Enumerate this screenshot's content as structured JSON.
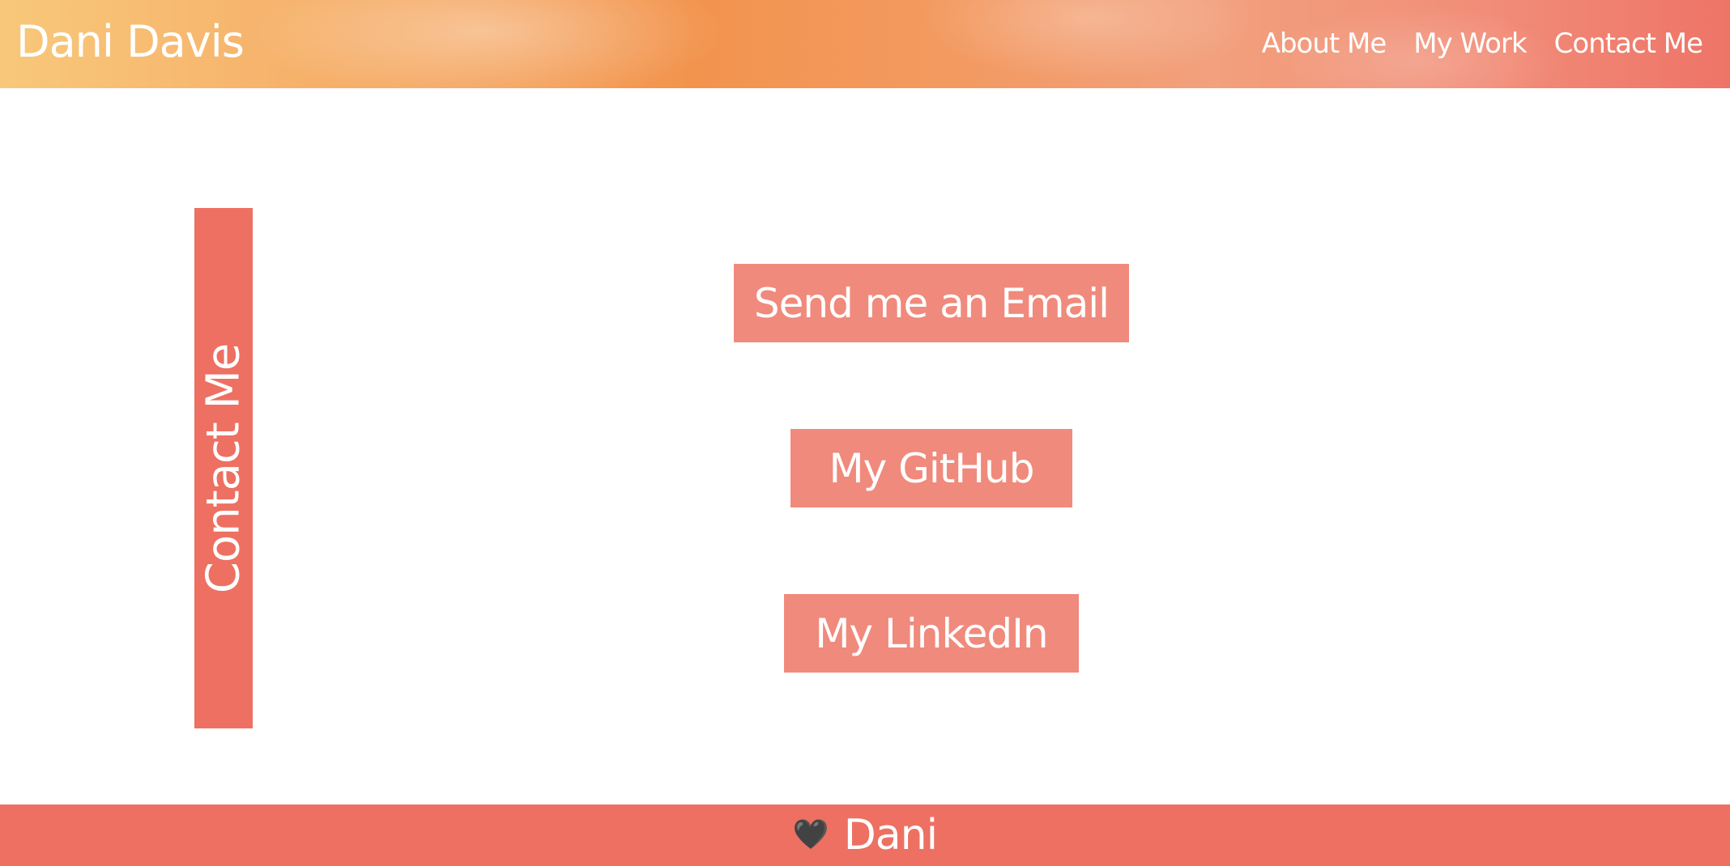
{
  "header": {
    "brand": "Dani Davis",
    "nav": [
      {
        "label": "About Me"
      },
      {
        "label": "My Work"
      },
      {
        "label": "Contact Me"
      }
    ]
  },
  "section": {
    "title": "Contact Me"
  },
  "buttons": {
    "email": "Send me an Email",
    "github": "My GitHub",
    "linkedin": "My LinkedIn"
  },
  "footer": {
    "heart_glyph": "🖤",
    "name": "Dani"
  },
  "colors": {
    "accent": "#ed7062",
    "button": "#f08a7c",
    "text_on_accent": "#ffffff"
  }
}
